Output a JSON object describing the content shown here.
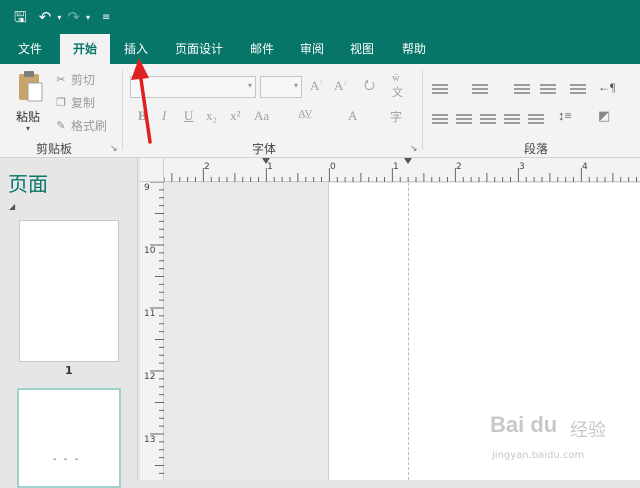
{
  "quick_access": {
    "save_icon": "save-icon",
    "undo_icon": "undo-icon",
    "redo_icon": "redo-icon",
    "customize_icon": "customize-icon"
  },
  "tabs": [
    {
      "label": "文件"
    },
    {
      "label": "开始"
    },
    {
      "label": "插入"
    },
    {
      "label": "页面设计"
    },
    {
      "label": "邮件"
    },
    {
      "label": "审阅"
    },
    {
      "label": "视图"
    },
    {
      "label": "帮助"
    }
  ],
  "ribbon": {
    "clipboard": {
      "paste_label": "粘贴",
      "cut_label": "剪切",
      "copy_label": "复制",
      "format_painter_label": "格式刷",
      "group_label": "剪贴板"
    },
    "font": {
      "group_label": "字体",
      "buttons": [
        "B",
        "I",
        "U",
        "x₂",
        "x²",
        "Aa",
        "A"
      ]
    },
    "paragraph": {
      "group_label": "段落"
    }
  },
  "pages_pane": {
    "title": "页面",
    "page1_number": "1",
    "page2_marks": "- - -"
  },
  "hruler_labels": [
    "2",
    "1",
    "0",
    "1",
    "2",
    "3",
    "4"
  ],
  "vruler_labels": [
    "9",
    "10",
    "11",
    "12",
    "13"
  ],
  "watermark": {
    "brand": "Bai du",
    "brand_cn": "经验",
    "url": "jingyan.baidu.com"
  },
  "colors": {
    "accent": "#077568",
    "annotation_arrow": "#e02020"
  }
}
